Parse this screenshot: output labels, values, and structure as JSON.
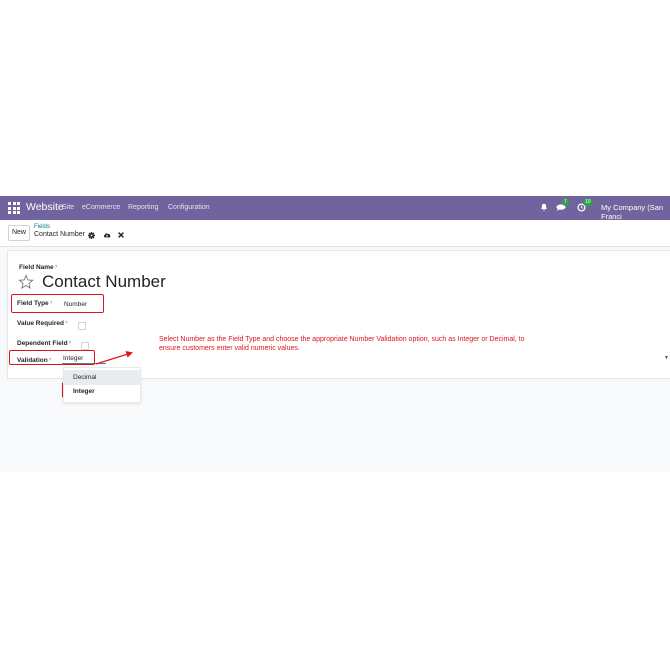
{
  "navbar": {
    "app_name": "Website",
    "menu": [
      "Site",
      "eCommerce",
      "Reporting",
      "Configuration"
    ],
    "chat_badge": "7",
    "activity_badge": "10",
    "company": "My Company (San Franci"
  },
  "control_panel": {
    "new_label": "New",
    "breadcrumb_parent": "Fields",
    "breadcrumb_current": "Contact Number"
  },
  "form": {
    "field_name_label": "Field Name",
    "record_title": "Contact Number",
    "field_type_label": "Field Type",
    "field_type_value": "Number",
    "value_required_label": "Value Required",
    "dependent_field_label": "Dependent Field",
    "validation_label": "Validation",
    "validation_value": "Integer",
    "help_mark": "?"
  },
  "dropdown": {
    "options": [
      "Decimal",
      "Integer"
    ],
    "selected": "Integer"
  },
  "annotation": {
    "text": "Select Number as the Field Type and choose the appropriate Number Validation option, such as Integer or Decimal, to ensure customers enter valid numeric values.",
    "color": "#e0141e"
  },
  "colors": {
    "navbar": "#71639e",
    "accent": "#017e84",
    "highlight": "#e0141e"
  }
}
